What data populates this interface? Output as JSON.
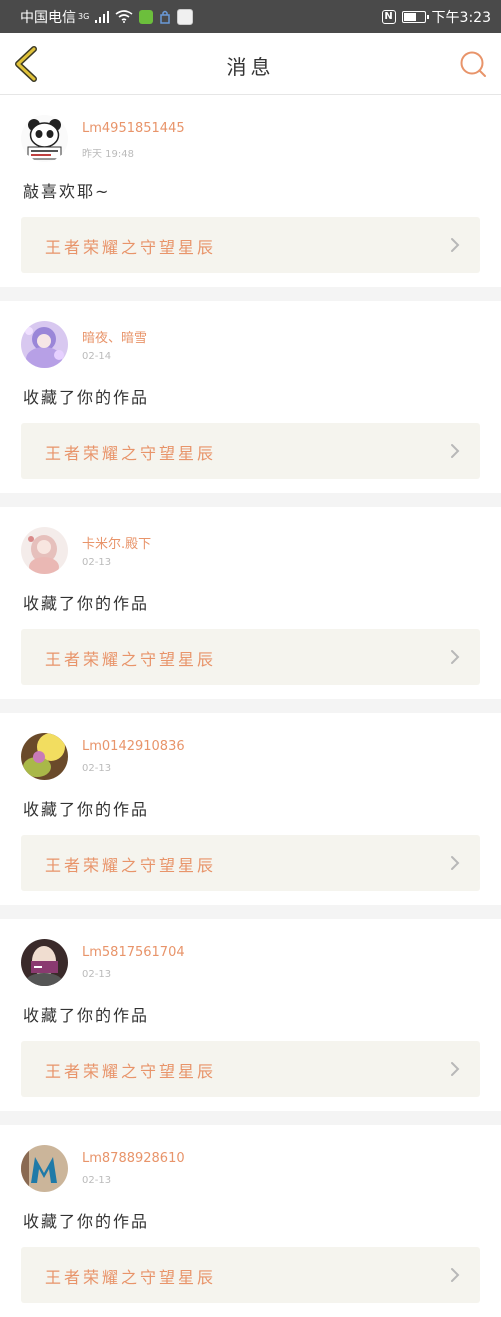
{
  "status_bar": {
    "carrier": "中国电信",
    "network": "3G",
    "time": "下午3:23",
    "battery_percent": 65,
    "icons": [
      "signal-icon",
      "wifi-icon",
      "wechat-icon",
      "sim-icon",
      "app-icon",
      "nfc-icon",
      "battery-icon"
    ]
  },
  "header": {
    "title": "消息",
    "back_icon": "chevron-left-icon",
    "search_icon": "search-icon"
  },
  "colors": {
    "accent": "#e8946a",
    "back_arrow": "#e0c23a",
    "link_bg": "#f5f4ee",
    "separator": "#f4f4f4"
  },
  "messages": [
    {
      "user": "Lm4951851445",
      "time": "昨天 19:48",
      "text": "敲喜欢耶~",
      "work": "王者荣耀之守望星辰",
      "avatar": "panda"
    },
    {
      "user": "暗夜、暗雪",
      "time": "02-14",
      "text": "收藏了你的作品",
      "work": "王者荣耀之守望星辰",
      "avatar": "purple"
    },
    {
      "user": "卡米尔.殿下",
      "time": "02-13",
      "text": "收藏了你的作品",
      "work": "王者荣耀之守望星辰",
      "avatar": "pink"
    },
    {
      "user": "Lm0142910836",
      "time": "02-13",
      "text": "收藏了你的作品",
      "work": "王者荣耀之守望星辰",
      "avatar": "yellow"
    },
    {
      "user": "Lm5817561704",
      "time": "02-13",
      "text": "收藏了你的作品",
      "work": "王者荣耀之守望星辰",
      "avatar": "portrait"
    },
    {
      "user": "Lm8788928610",
      "time": "02-13",
      "text": "收藏了你的作品",
      "work": "王者荣耀之守望星辰",
      "avatar": "letter-m"
    }
  ]
}
